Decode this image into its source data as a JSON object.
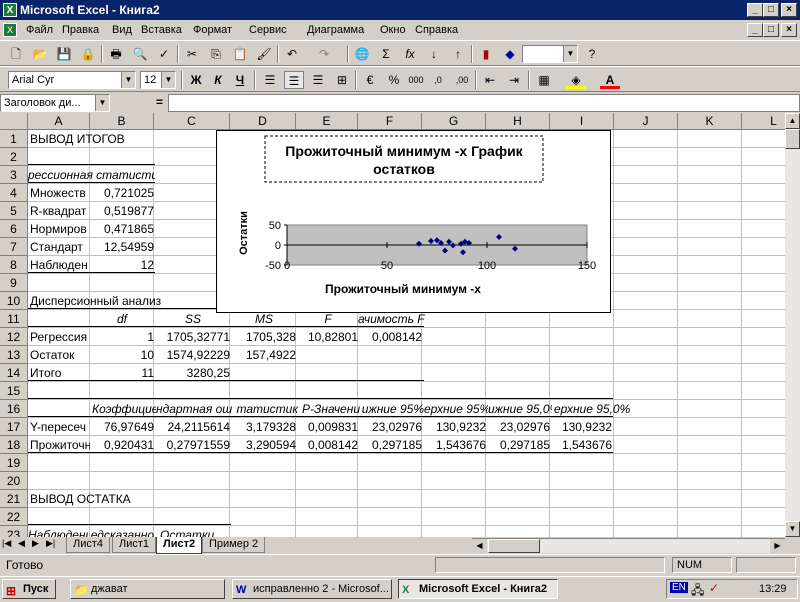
{
  "window": {
    "title": "Microsoft Excel - Книга2"
  },
  "menu": [
    "Файл",
    "Правка",
    "Вид",
    "Вставка",
    "Формат",
    "Сервис",
    "Диаграмма",
    "Окно",
    "Справка"
  ],
  "format": {
    "font": "Arial Cyr",
    "size": "12",
    "bold": "Ж",
    "italic": "К",
    "underline": "Ч"
  },
  "namebox": "Заголовок ди...",
  "formula_eq": "=",
  "columns": [
    "A",
    "B",
    "C",
    "D",
    "E",
    "F",
    "G",
    "H",
    "I",
    "J",
    "K",
    "L"
  ],
  "rows": [
    "1",
    "2",
    "3",
    "4",
    "5",
    "6",
    "7",
    "8",
    "9",
    "10",
    "11",
    "12",
    "13",
    "14",
    "15",
    "16",
    "17",
    "18",
    "19",
    "20",
    "21",
    "22",
    "23",
    "24"
  ],
  "cells": {
    "a1": "ВЫВОД ИТОГОВ",
    "a3": "рессионная статистика",
    "a4": "Множеств",
    "b4": "0,721025",
    "a5": "R-квадрат",
    "b5": "0,519877",
    "a6": "Нормиров",
    "b6": "0,471865",
    "a7": "Стандарт",
    "b7": "12,54959",
    "a8": "Наблюден",
    "b8": "12",
    "a10": "Дисперсионный анализ",
    "b11": "df",
    "c11": "SS",
    "d11": "MS",
    "e11": "F",
    "f11": "ачимость F",
    "a12": "Регрессия",
    "b12": "1",
    "c12": "1705,32771",
    "d12": "1705,328",
    "e12": "10,82801",
    "f12": "0,008142",
    "a13": "Остаток",
    "b13": "10",
    "c13": "1574,92229",
    "d13": "157,4922",
    "a14": "Итого",
    "b14": "11",
    "c14": "3280,25",
    "b16": "Коэффициен",
    "c16": "ндартная ош",
    "d16": "татистик",
    "e16": "Р-Значени",
    "f16": "ижние 95%",
    "g16": "ерхние 95%",
    "h16": "ижние 95,0%",
    "i16": "ерхние 95,0%",
    "a17": "Y-пересеч",
    "b17": "76,97649",
    "c17": "24,2115614",
    "d17": "3,179328",
    "e17": "0,009831",
    "f17": "23,02976",
    "g17": "130,9232",
    "h17": "23,02976",
    "i17": "130,9232",
    "a18": "Прожиточн",
    "b18": "0,920431",
    "c18": "0,27971559",
    "d18": "3,290594",
    "e18": "0,008142",
    "f18": "0,297185",
    "g18": "1,543676",
    "h18": "0,297185",
    "i18": "1,543676",
    "a22": "ВЫВОД ОСТАТКА",
    "a24": "Наблюдение",
    "b24": "едсказанно",
    "c24": "Остатки"
  },
  "chart_data": {
    "type": "scatter",
    "title": "Прожиточный минимум -х График остатков",
    "xlabel": "Прожиточный минимум -х",
    "ylabel": "Остатки",
    "xlim": [
      0,
      150
    ],
    "ylim": [
      -50,
      50
    ],
    "xticks": [
      "0",
      "50",
      "100",
      "150"
    ],
    "yticks": [
      "50",
      "0",
      "-50"
    ],
    "series": [
      {
        "color": "#000080",
        "points": [
          [
            66,
            3
          ],
          [
            72,
            10
          ],
          [
            75,
            12
          ],
          [
            77,
            5
          ],
          [
            79,
            -14
          ],
          [
            81,
            8
          ],
          [
            83,
            -1
          ],
          [
            87,
            3
          ],
          [
            88,
            -18
          ],
          [
            89,
            8
          ],
          [
            91,
            5
          ],
          [
            106,
            20
          ],
          [
            114,
            -9
          ]
        ]
      }
    ]
  },
  "sheets": [
    "Лист4",
    "Лист1",
    "Лист2",
    "Пример 2"
  ],
  "active_sheet": "Лист2",
  "status": {
    "ready": "Готово",
    "num": "NUM"
  },
  "taskbar": {
    "start": "Пуск",
    "items": [
      "джават",
      "исправленно 2 - Microsof...",
      "Microsoft Excel - Книга2"
    ],
    "lang": "EN",
    "time": "13:29"
  }
}
